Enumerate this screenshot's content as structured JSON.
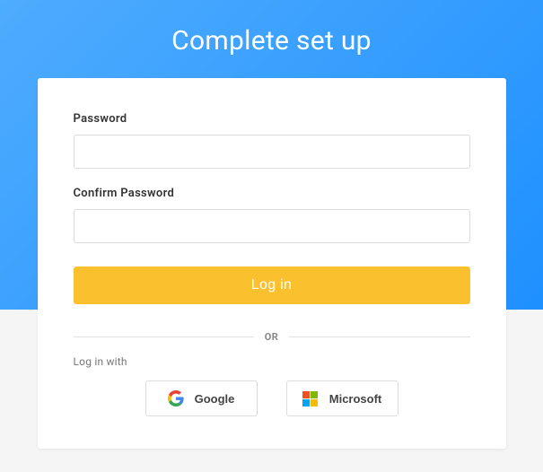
{
  "page": {
    "title": "Complete set up"
  },
  "form": {
    "password_label": "Password",
    "password_value": "",
    "confirm_password_label": "Confirm Password",
    "confirm_password_value": "",
    "login_button_label": "Log in"
  },
  "divider": {
    "text": "OR"
  },
  "social": {
    "login_with_label": "Log in with",
    "google_label": "Google",
    "microsoft_label": "Microsoft"
  }
}
